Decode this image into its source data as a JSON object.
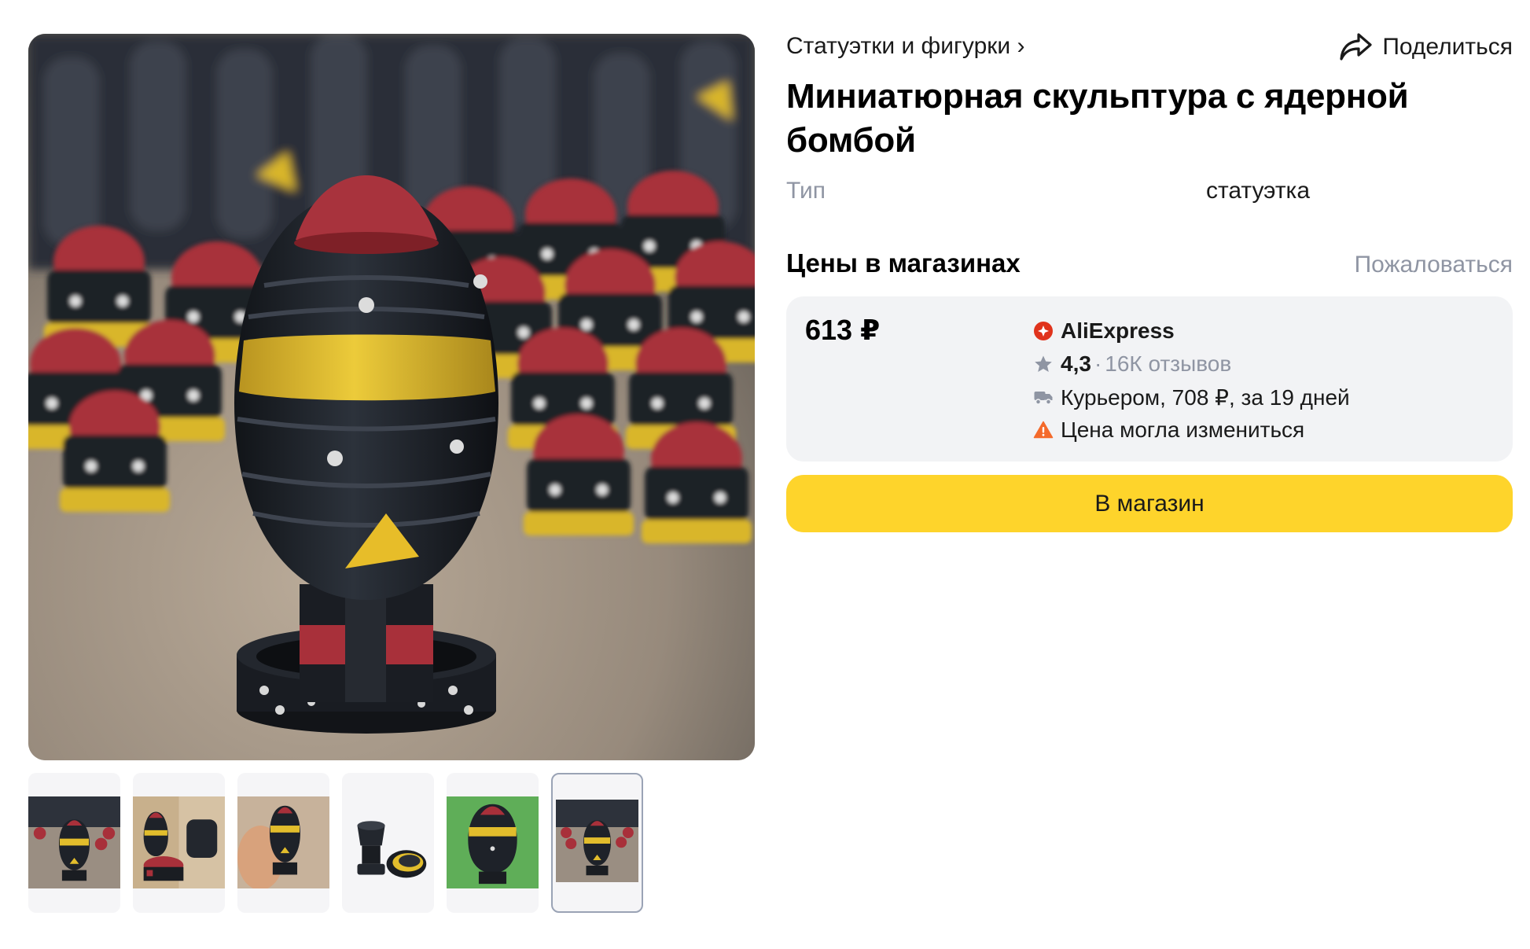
{
  "gallery": {
    "main_image_alt": "Миниатюрная скульптура с ядерной бомбой",
    "thumbnail_count": 6,
    "active_thumbnail_index": 5
  },
  "breadcrumb": {
    "category": "Статуэтки и фигурки ›"
  },
  "share": {
    "label": "Поделиться",
    "icon": "share-arrow-icon"
  },
  "product": {
    "title": "Миниатюрная скульптура с ядерной бомбой",
    "specs": [
      {
        "label": "Тип",
        "value": "статуэтка"
      }
    ]
  },
  "prices_section": {
    "title": "Цены в магазинах",
    "complain_label": "Пожаловаться"
  },
  "offer": {
    "price": "613 ₽",
    "shop_name": "AliExpress",
    "shop_icon": "aliexpress-logo-icon",
    "rating": "4,3",
    "rating_separator": "·",
    "reviews": "16К отзывов",
    "delivery": "Курьером, 708 ₽, за 19 дней",
    "warning": "Цена могла измениться",
    "button_label": "В магазин"
  },
  "colors": {
    "accent_button": "#fed42b",
    "card_background": "#f2f3f5",
    "muted_text": "#8f95a3",
    "shop_red": "#e0331c",
    "warning_orange": "#f46a2b",
    "bomb_red": "#b0323d",
    "bomb_yellow": "#e8c22c",
    "bomb_black": "#1f232b"
  }
}
